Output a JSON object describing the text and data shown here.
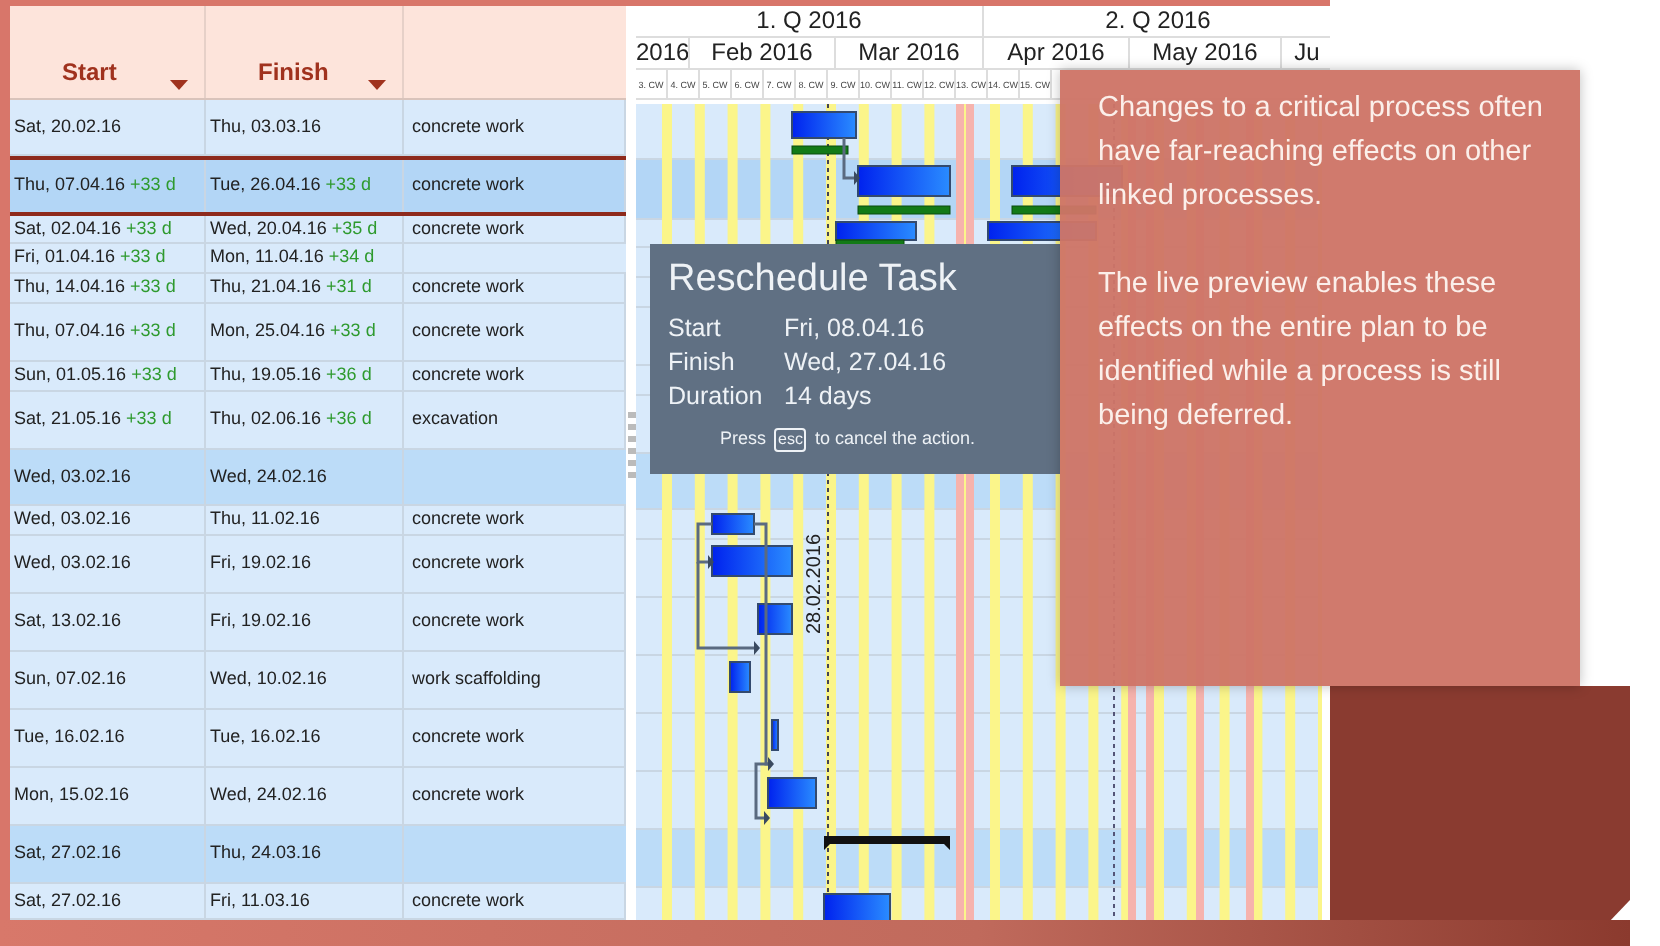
{
  "table": {
    "columns": [
      {
        "label": "Start"
      },
      {
        "label": "Finish"
      }
    ],
    "rows": [
      {
        "kind": "task",
        "selected": false,
        "start": {
          "date": "Sat, 20.02.16"
        },
        "finish": {
          "date": "Thu, 03.03.16"
        },
        "name": "concrete work"
      },
      {
        "kind": "task",
        "selected": true,
        "start": {
          "date": "Thu, 07.04.16",
          "shift": "+33 d"
        },
        "finish": {
          "date": "Tue, 26.04.16",
          "shift": "+33 d"
        },
        "name": "concrete work"
      },
      {
        "kind": "task",
        "selected": false,
        "start": {
          "date": "Sat, 02.04.16",
          "shift": "+33 d"
        },
        "finish": {
          "date": "Wed, 20.04.16",
          "shift": "+35 d"
        },
        "name": "concrete work"
      },
      {
        "kind": "task",
        "selected": false,
        "start": {
          "date": "Fri, 01.04.16",
          "shift": "+33 d"
        },
        "finish": {
          "date": "Mon, 11.04.16",
          "shift": "+34 d"
        }
      },
      {
        "kind": "task",
        "selected": false,
        "start": {
          "date": "Thu, 14.04.16",
          "shift": "+33 d"
        },
        "finish": {
          "date": "Thu, 21.04.16",
          "shift": "+31 d"
        },
        "name": "concrete work"
      },
      {
        "kind": "task",
        "selected": false,
        "start": {
          "date": "Thu, 07.04.16",
          "shift": "+33 d"
        },
        "finish": {
          "date": "Mon, 25.04.16",
          "shift": "+33 d"
        },
        "name": "concrete work"
      },
      {
        "kind": "task",
        "selected": false,
        "start": {
          "date": "Sun, 01.05.16",
          "shift": "+33 d"
        },
        "finish": {
          "date": "Thu, 19.05.16",
          "shift": "+36 d"
        },
        "name": "concrete work"
      },
      {
        "kind": "task",
        "selected": false,
        "start": {
          "date": "Sat, 21.05.16",
          "shift": "+33 d"
        },
        "finish": {
          "date": "Thu, 02.06.16",
          "shift": "+36 d"
        },
        "name": "excavation"
      },
      {
        "kind": "summary",
        "selected": false,
        "start": {
          "date": "Wed, 03.02.16"
        },
        "finish": {
          "date": "Wed, 24.02.16"
        }
      },
      {
        "kind": "task",
        "selected": false,
        "start": {
          "date": "Wed, 03.02.16"
        },
        "finish": {
          "date": "Thu, 11.02.16"
        },
        "name": "concrete work"
      },
      {
        "kind": "task",
        "selected": false,
        "start": {
          "date": "Wed, 03.02.16"
        },
        "finish": {
          "date": "Fri, 19.02.16"
        },
        "name": "concrete work"
      },
      {
        "kind": "task",
        "selected": false,
        "start": {
          "date": "Sat, 13.02.16"
        },
        "finish": {
          "date": "Fri, 19.02.16"
        },
        "name": "concrete work"
      },
      {
        "kind": "task",
        "selected": false,
        "start": {
          "date": "Sun, 07.02.16"
        },
        "finish": {
          "date": "Wed, 10.02.16"
        },
        "name": "work scaffolding"
      },
      {
        "kind": "task",
        "selected": false,
        "start": {
          "date": "Tue, 16.02.16"
        },
        "finish": {
          "date": "Tue, 16.02.16"
        },
        "name": "concrete work"
      },
      {
        "kind": "task",
        "selected": false,
        "start": {
          "date": "Mon, 15.02.16"
        },
        "finish": {
          "date": "Wed, 24.02.16"
        },
        "name": "concrete work"
      },
      {
        "kind": "summary",
        "selected": false,
        "start": {
          "date": "Sat, 27.02.16"
        },
        "finish": {
          "date": "Thu, 24.03.16"
        }
      },
      {
        "kind": "task",
        "selected": false,
        "start": {
          "date": "Sat, 27.02.16"
        },
        "finish": {
          "date": "Fri, 11.03.16"
        },
        "name": "concrete work"
      }
    ]
  },
  "timeline": {
    "quarters": [
      "1. Q 2016",
      "2. Q 2016"
    ],
    "months": [
      "2016",
      "Feb 2016",
      "Mar 2016",
      "Apr 2016",
      "May 2016",
      "Ju"
    ],
    "weeks": [
      "3. CW",
      "4. CW",
      "5. CW",
      "6. CW",
      "7. CW",
      "8. CW",
      "9. CW",
      "10. CW",
      "11. CW",
      "12. CW",
      "13. CW",
      "14. CW",
      "15. CW"
    ],
    "date_marker": "28.02.2016"
  },
  "tooltip": {
    "title": "Reschedule Task",
    "fields": [
      {
        "label": "Start",
        "value": "Fri, 08.04.16"
      },
      {
        "label": "Finish",
        "value": "Wed, 27.04.16"
      },
      {
        "label": "Duration",
        "value": "14 days"
      }
    ],
    "hint": {
      "before": "Press",
      "key": "esc",
      "after": "to cancel the action."
    }
  },
  "callout": {
    "paragraphs": [
      "Changes to a critical process often have far-reaching effects on other linked processes.",
      "The live preview enables these effects on the entire plan to be identified while a process is still being deferred."
    ]
  }
}
